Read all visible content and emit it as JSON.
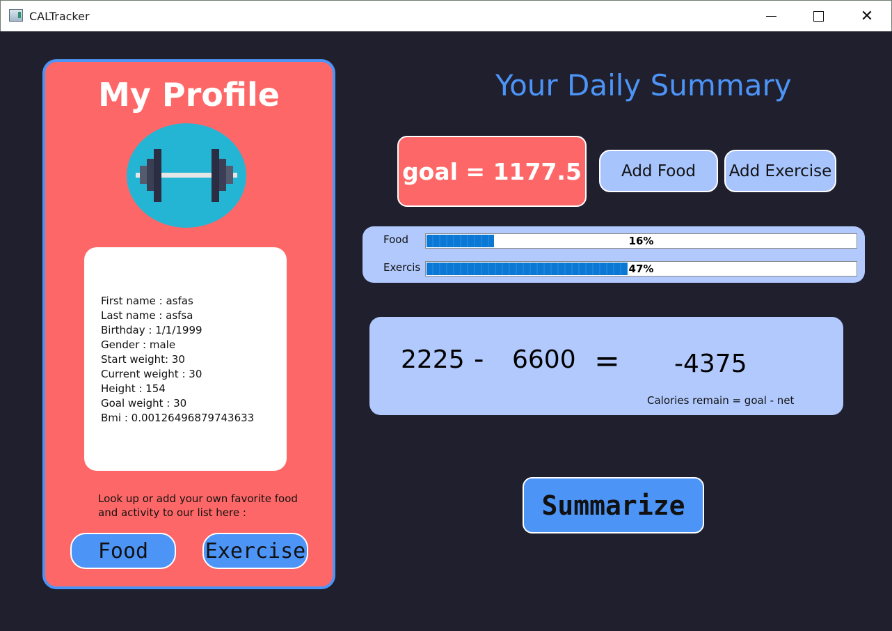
{
  "window": {
    "title": "CALTracker",
    "minimize_icon": "minimize-icon",
    "maximize_icon": "maximize-icon",
    "close_icon": "close-icon",
    "close_glyph": "✕"
  },
  "profile": {
    "title": "My Profile",
    "avatar_icon": "dumbbell-icon",
    "colors": {
      "card": "#fe6767",
      "border": "#4d94f7",
      "avatar_bg": "#25b5d4"
    },
    "info": [
      "First name : asfas",
      "Last name : asfsa",
      "Birthday : 1/1/1999",
      "Gender : male",
      "Start weight: 30",
      "Current weight : 30",
      "Height : 154",
      "Goal weight : 30",
      "Bmi : 0.00126496879743633"
    ],
    "lookup_text_line1": "Look up or add your own favorite food",
    "lookup_text_line2": "and activity to our list here :",
    "food_button": "Food",
    "exercise_button": "Exercise"
  },
  "summary": {
    "title": "Your Daily Summary",
    "goal": "goal = 1177.5",
    "add_food_button": "Add Food",
    "add_exercise_button": "Add Exercise",
    "progress": {
      "food": {
        "label": "Food",
        "percent": 16,
        "text": "16%"
      },
      "exercise": {
        "label": "Exercis",
        "percent": 47,
        "text": "47%"
      }
    },
    "equation": {
      "consumed": "2225",
      "minus": "-",
      "burned": "6600",
      "equals": "=",
      "result": "-4375",
      "caption": "Calories remain = goal - net"
    },
    "summarize_button": "Summarize"
  },
  "colors": {
    "background": "#1f1f2e",
    "accent_blue": "#4d94f7",
    "panel_blue": "#b1c9fd",
    "button_light": "#a7c4fc",
    "coral": "#fe6767"
  }
}
